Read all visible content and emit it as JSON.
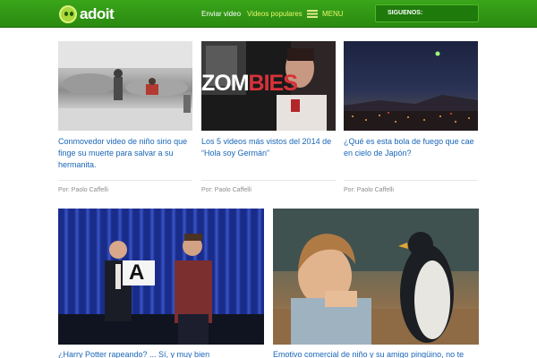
{
  "header": {
    "logo_text": "adoit",
    "nav": {
      "enviar": "Enviar video",
      "populares": "Videos populares",
      "menu": "MENU"
    },
    "follow_label": "SIGUENOS:"
  },
  "colors": {
    "header_green": "#2a8a10",
    "accent_yellow": "#e7f56a",
    "link_blue": "#1a66b8",
    "author_gray": "#8d8d8d"
  },
  "cards": [
    {
      "title": "Conmovedor video de niño sirio que finge su muerte para salvar a su hermanita.",
      "author": "Por: Paolo Caffelli"
    },
    {
      "title": "Los 5 videos más vistos del 2014 de “Hola soy Germán”",
      "author": "Por: Paolo Caffelli",
      "thumb_text_a": "ZOM",
      "thumb_text_b": "BIES"
    },
    {
      "title": "¿Qué es esta bola de fuego que cae en cielo de Japón?",
      "author": "Por: Paolo Caffelli"
    },
    {
      "title": "¿Harry Potter rapeando? ... Sí, y muy bien",
      "card_letter": "A"
    },
    {
      "title": "Emotivo comercial de niño y su amigo pingüino, no te"
    }
  ]
}
